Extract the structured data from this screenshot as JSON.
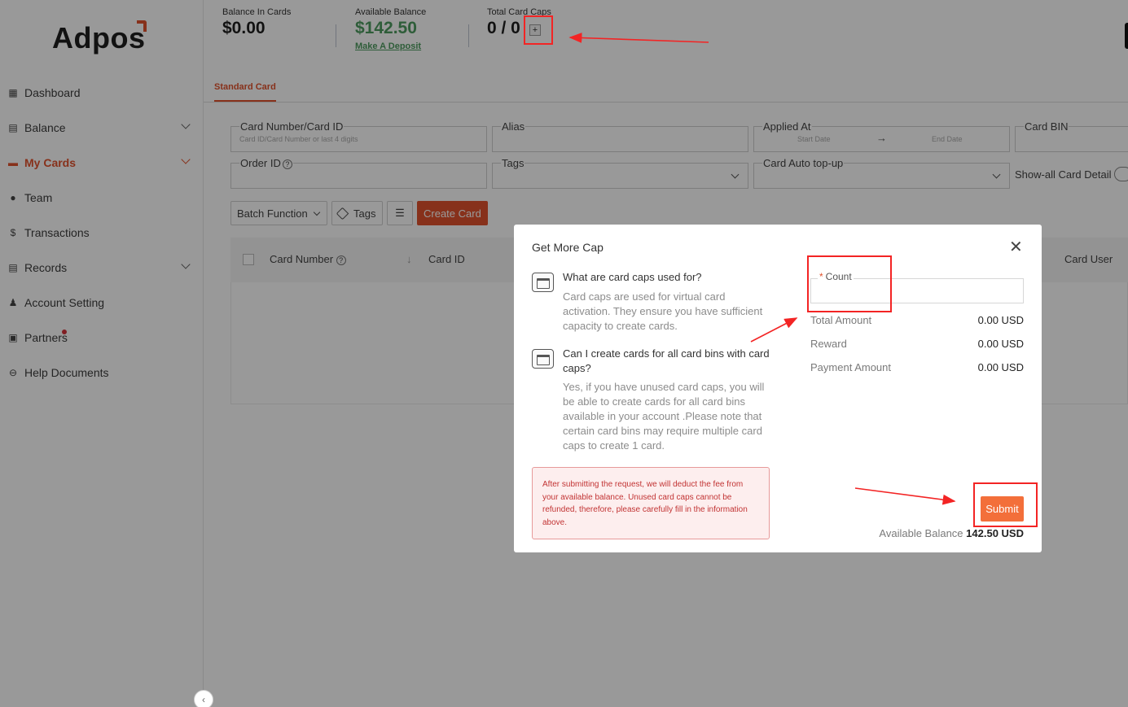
{
  "app": {
    "logo": "Adpos"
  },
  "sidebar": {
    "items": [
      {
        "label": "Dashboard",
        "icon": "dashboard-icon",
        "active": false,
        "has_children": false
      },
      {
        "label": "Balance",
        "icon": "balance-icon",
        "active": false,
        "has_children": true
      },
      {
        "label": "My Cards",
        "icon": "card-icon",
        "active": true,
        "has_children": true
      },
      {
        "label": "Team",
        "icon": "team-icon",
        "active": false,
        "has_children": false
      },
      {
        "label": "Transactions",
        "icon": "transactions-icon",
        "active": false,
        "has_children": false
      },
      {
        "label": "Records",
        "icon": "records-icon",
        "active": false,
        "has_children": true
      },
      {
        "label": "Account Setting",
        "icon": "user-icon",
        "active": false,
        "has_children": false
      },
      {
        "label": "Partners",
        "icon": "partners-icon",
        "active": false,
        "has_children": false,
        "badge_dot": true
      },
      {
        "label": "Help Documents",
        "icon": "link-icon",
        "active": false,
        "has_children": false
      }
    ],
    "collapse_glyph": "‹"
  },
  "header": {
    "balance_in_cards_label": "Balance In Cards",
    "balance_in_cards_value": "$0.00",
    "available_balance_label": "Available Balance",
    "available_balance_value": "$142.50",
    "make_deposit": "Make A Deposit",
    "total_card_caps_label": "Total Card Caps",
    "total_card_caps_value": "0 / 0",
    "add_caps_glyph": "+"
  },
  "tabs": {
    "standard_card": "Standard Card"
  },
  "filters": {
    "card_number_label": "Card Number/Card ID",
    "card_number_placeholder": "Card ID/Card Number or last 4 digits",
    "alias_label": "Alias",
    "applied_at_label": "Applied At",
    "start_date": "Start Date",
    "end_date": "End Date",
    "range_arrow": "→",
    "card_bin_label": "Card BIN",
    "order_id_label": "Order ID",
    "order_id_help": "?",
    "tags_label": "Tags",
    "auto_topup_label": "Card Auto top-up",
    "show_all_label": "Show-all Card Detail"
  },
  "toolbar": {
    "batch_function": "Batch Function",
    "tags": "Tags",
    "list_glyph": "☰",
    "create_card": "Create Card"
  },
  "table": {
    "columns": [
      "Card Number",
      "Card ID",
      "Card User"
    ],
    "help_glyph": "?",
    "sort_glyph": "↓"
  },
  "modal": {
    "title": "Get More Cap",
    "close_glyph": "✕",
    "q1": "What are card caps used for?",
    "a1": "Card caps are used for virtual card activation. They ensure you have sufficient capacity to create cards.",
    "q2": "Can I create cards for all card bins with card caps?",
    "a2": "Yes, if you have unused card caps, you will be able to create cards for all card bins available in your account .Please note that certain card bins may require multiple card caps to create 1 card.",
    "warning": "After submitting the request, we will deduct the fee from your available balance. Unused card caps cannot be refunded, therefore, please carefully fill in the information above.",
    "count_required": "*",
    "count_label": "Count",
    "count_value": "",
    "total_amount_label": "Total Amount",
    "total_amount_value": "0.00 USD",
    "reward_label": "Reward",
    "reward_value": "0.00 USD",
    "payment_amount_label": "Payment Amount",
    "payment_amount_value": "0.00 USD",
    "submit": "Submit",
    "available_balance_label": "Available Balance",
    "available_balance_value": "142.50 USD"
  },
  "colors": {
    "brand": "#e2532d",
    "submit": "#f36f3a",
    "green": "#4e9c5f",
    "annotation_red": "#f32424"
  }
}
